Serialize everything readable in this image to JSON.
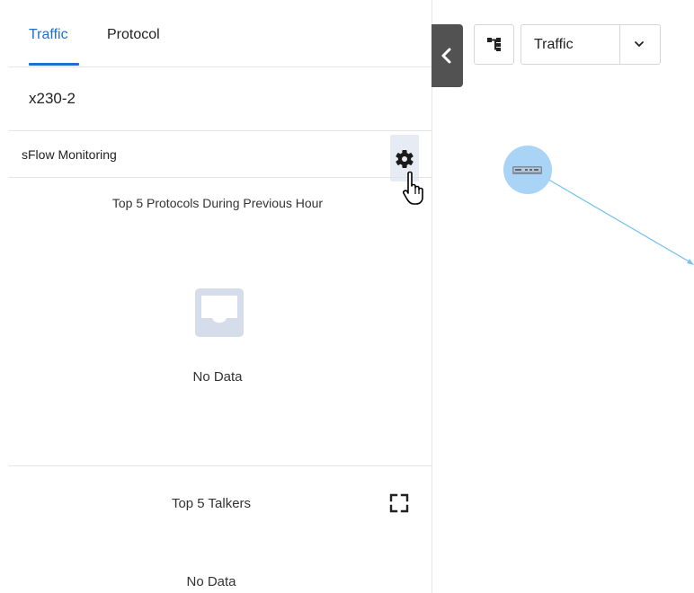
{
  "tabs": [
    {
      "label": "Traffic",
      "active": true
    },
    {
      "label": "Protocol",
      "active": false
    }
  ],
  "device": {
    "name": "x230-2"
  },
  "sflow": {
    "title": "sFlow Monitoring"
  },
  "protocols_widget": {
    "title": "Top 5 Protocols During Previous Hour",
    "empty_text": "No Data"
  },
  "talkers_widget": {
    "title": "Top 5 Talkers",
    "empty_text": "No Data"
  },
  "toolbar": {
    "layer_select_value": "Traffic"
  },
  "icons": {
    "gear": "gear-icon",
    "inbox": "inbox-icon",
    "expand": "expand-icon",
    "collapse": "chevron-left-icon",
    "tree": "tree-icon",
    "dropdown": "chevron-down-icon",
    "device": "switch-icon"
  },
  "colors": {
    "accent": "#1f6fd1",
    "node": "#a9d4f5",
    "link": "#7cc4f0"
  }
}
